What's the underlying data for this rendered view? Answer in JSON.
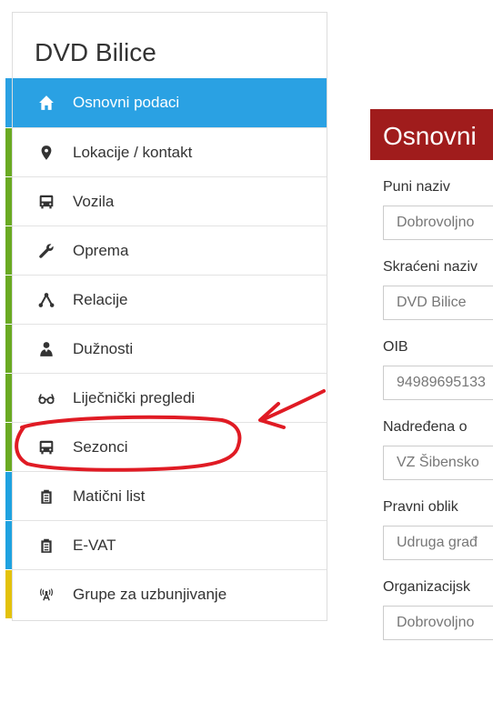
{
  "sidebar": {
    "title": "DVD Bilice",
    "items": [
      {
        "label": "Osnovni podaci",
        "icon": "home-icon",
        "stripe": "#2aa1e3",
        "active": true
      },
      {
        "label": "Lokacije / kontakt",
        "icon": "map-marker-icon",
        "stripe": "#6aaa22"
      },
      {
        "label": "Vozila",
        "icon": "bus-icon",
        "stripe": "#6aaa22"
      },
      {
        "label": "Oprema",
        "icon": "wrench-icon",
        "stripe": "#6aaa22"
      },
      {
        "label": "Relacije",
        "icon": "network-icon",
        "stripe": "#6aaa22"
      },
      {
        "label": "Dužnosti",
        "icon": "user-tie-icon",
        "stripe": "#6aaa22"
      },
      {
        "label": "Liječnički pregledi",
        "icon": "glasses-icon",
        "stripe": "#6aaa22"
      },
      {
        "label": "Sezonci",
        "icon": "bus-icon",
        "stripe": "#6aaa22"
      },
      {
        "label": "Matični list",
        "icon": "clipboard-icon",
        "stripe": "#1fa2e0"
      },
      {
        "label": "E-VAT",
        "icon": "clipboard-icon",
        "stripe": "#1fa2e0"
      },
      {
        "label": "Grupe za uzbunjivanje",
        "icon": "broadcast-icon",
        "stripe": "#e3c20c"
      }
    ]
  },
  "panel": {
    "title": "Osnovni",
    "fields": [
      {
        "label": "Puni naziv",
        "value": "Dobrovoljno"
      },
      {
        "label": "Skraćeni naziv",
        "value": "DVD Bilice"
      },
      {
        "label": "OIB",
        "value": "94989695133"
      },
      {
        "label": "Nadređena o",
        "value": "VZ Šibensko"
      },
      {
        "label": "Pravni oblik",
        "value": "Udruga građ"
      },
      {
        "label": "Organizacijsk",
        "value": "Dobrovoljno"
      }
    ]
  },
  "colors": {
    "active": "#2aa1e3",
    "header": "#a01c1c",
    "annotation": "#e01b24"
  }
}
